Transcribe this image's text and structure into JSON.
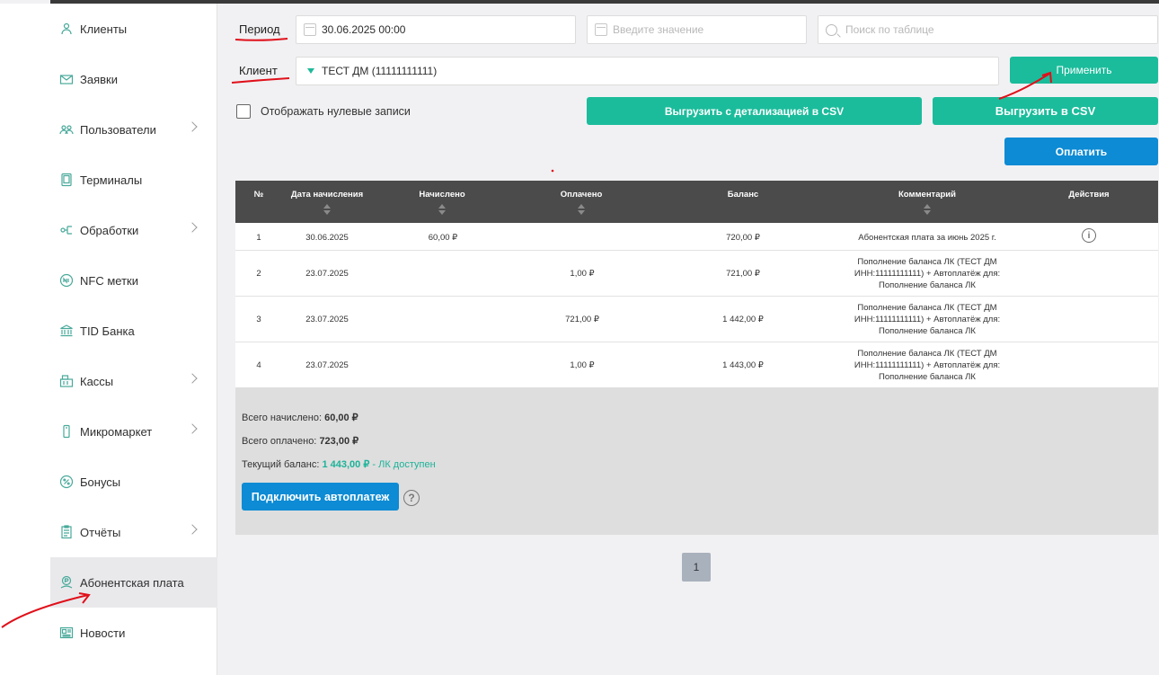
{
  "sidebar": {
    "items": [
      {
        "label": "Клиенты",
        "icon": "clients-icon",
        "has_children": false
      },
      {
        "label": "Заявки",
        "icon": "envelope-icon",
        "has_children": false
      },
      {
        "label": "Пользователи",
        "icon": "users-icon",
        "has_children": true
      },
      {
        "label": "Терминалы",
        "icon": "terminal-icon",
        "has_children": false
      },
      {
        "label": "Обработки",
        "icon": "processing-icon",
        "has_children": true
      },
      {
        "label": "NFC метки",
        "icon": "nfc-icon",
        "has_children": false
      },
      {
        "label": "TID Банка",
        "icon": "bank-icon",
        "has_children": false
      },
      {
        "label": "Кассы",
        "icon": "cashbox-icon",
        "has_children": true
      },
      {
        "label": "Микромаркет",
        "icon": "micromarket-icon",
        "has_children": true
      },
      {
        "label": "Бонусы",
        "icon": "percent-icon",
        "has_children": false
      },
      {
        "label": "Отчёты",
        "icon": "report-icon",
        "has_children": true
      },
      {
        "label": "Абонентская плата",
        "icon": "subscription-icon",
        "has_children": false,
        "active": true
      },
      {
        "label": "Новости",
        "icon": "news-icon",
        "has_children": false
      }
    ]
  },
  "filters": {
    "period_label": "Период",
    "period_value": "30.06.2025 00:00",
    "period_end_placeholder": "Введите значение",
    "search_placeholder": "Поиск по таблице",
    "client_label": "Клиент",
    "client_value": "ТЕСТ ДМ (11111111111)",
    "apply_label": "Применить",
    "show_zero_label": "Отображать нулевые записи",
    "export_detailed_label": "Выгрузить с детализацией в CSV",
    "export_label": "Выгрузить в CSV",
    "pay_label": "Оплатить"
  },
  "table": {
    "headers": [
      "№",
      "Дата начисления",
      "Начислено",
      "Оплачено",
      "Баланс",
      "Комментарий",
      "Действия"
    ],
    "rows": [
      {
        "num": "1",
        "date": "30.06.2025",
        "charged": "60,00 ₽",
        "paid": "",
        "balance": "720,00 ₽",
        "comment": [
          "Абонентская плата за июнь 2025 г."
        ],
        "action": "info-icon"
      },
      {
        "num": "2",
        "date": "23.07.2025",
        "charged": "",
        "paid": "1,00 ₽",
        "balance": "721,00 ₽",
        "comment": [
          "Пополнение баланса ЛК (ТЕСТ ДМ",
          "ИНН:11111111111) + Автоплатёж для:",
          "Пополнение баланса ЛК"
        ]
      },
      {
        "num": "3",
        "date": "23.07.2025",
        "charged": "",
        "paid": "721,00 ₽",
        "balance": "1 442,00 ₽",
        "comment": [
          "Пополнение баланса ЛК (ТЕСТ ДМ",
          "ИНН:11111111111) + Автоплатёж для:",
          "Пополнение баланса ЛК"
        ]
      },
      {
        "num": "4",
        "date": "23.07.2025",
        "charged": "",
        "paid": "1,00 ₽",
        "balance": "1 443,00 ₽",
        "comment": [
          "Пополнение баланса ЛК (ТЕСТ ДМ",
          "ИНН:11111111111) + Автоплатёж для:",
          "Пополнение баланса ЛК"
        ]
      }
    ]
  },
  "summary": {
    "total_charged_label": "Всего начислено:",
    "total_charged": "60,00 ₽",
    "total_paid_label": "Всего оплачено:",
    "total_paid": "723,00 ₽",
    "balance_label": "Текущий баланс:",
    "balance": "1 443,00 ₽",
    "balance_status": "- ЛК доступен",
    "autopay_label": "Подключить автоплатеж",
    "help_glyph": "?"
  },
  "pagination": {
    "current": "1"
  },
  "colors": {
    "accent_green": "#1bbc9b",
    "accent_blue": "#0d8bd4",
    "table_header": "#4b4b4b",
    "annotation_red": "#e0101a"
  }
}
